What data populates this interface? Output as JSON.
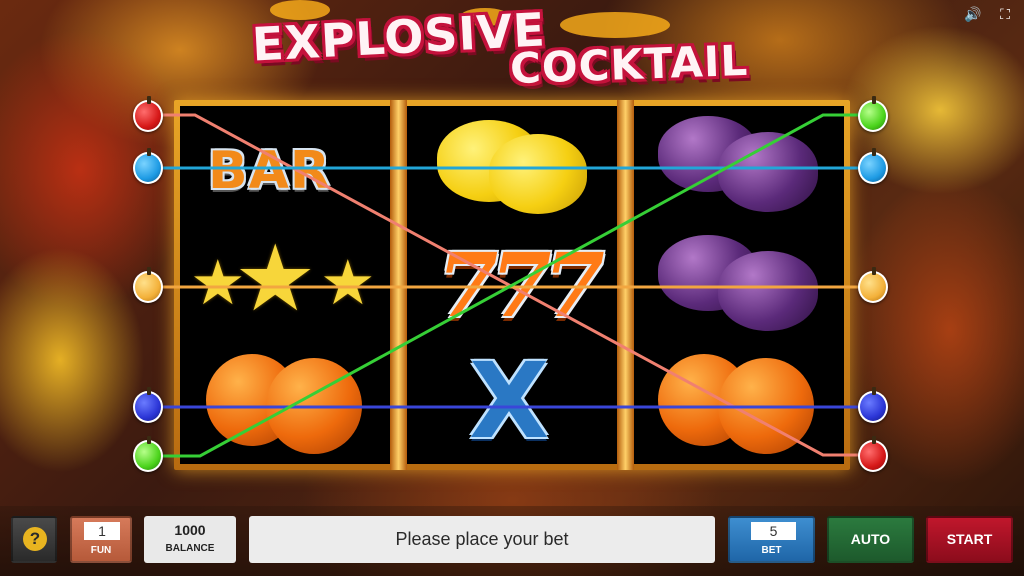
{
  "game": {
    "title_line1": "EXPLOSIVE",
    "title_line2": "COCKTAIL"
  },
  "top_controls": {
    "sound_icon": "speaker-icon",
    "fullscreen_icon": "fullscreen-icon"
  },
  "reels": [
    {
      "symbols": [
        "bar",
        "stars",
        "orange"
      ],
      "bar_label": "BAR"
    },
    {
      "symbols": [
        "lemon",
        "seven",
        "x"
      ],
      "seven_label": "777",
      "x_label": "X"
    },
    {
      "symbols": [
        "plum",
        "plum",
        "orange"
      ]
    }
  ],
  "paylines": [
    {
      "color": "#f08070",
      "marker": "red-apple",
      "path": "top-left to bottom-right"
    },
    {
      "color": "#22a6d8",
      "marker": "blue-apple",
      "path": "top row"
    },
    {
      "color": "#f2a640",
      "marker": "orange-apple",
      "path": "middle row"
    },
    {
      "color": "#3a46d8",
      "marker": "navy-apple",
      "path": "bottom row"
    },
    {
      "color": "#36cf36",
      "marker": "green-apple",
      "path": "bottom-left to top-right"
    }
  ],
  "bottom_bar": {
    "help_label": "?",
    "fun_value": "1",
    "fun_label": "FUN",
    "balance_value": "1000",
    "balance_label": "BALANCE",
    "message": "Please place your bet",
    "bet_value": "5",
    "bet_label": "BET",
    "auto_label": "AUTO",
    "start_label": "START"
  }
}
